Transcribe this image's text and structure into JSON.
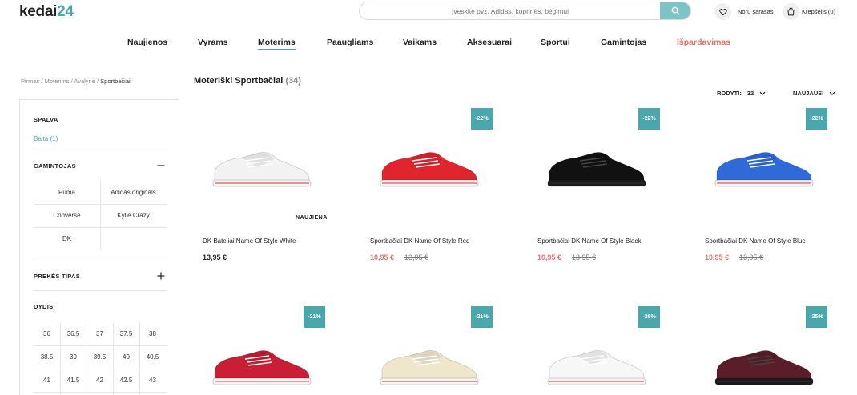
{
  "header": {
    "logo_part1": "kedai",
    "logo_part2": "24",
    "search_placeholder": "Įveskite pvz. Adidas, kuprinės, bėgimui",
    "wishlist_label": "Norų sąrašas",
    "cart_label": "Krepšelis (0)"
  },
  "nav": {
    "items": [
      "Naujienos",
      "Vyrams",
      "Moterims",
      "Paaugliams",
      "Vaikams",
      "Aksesuarai",
      "Sportui",
      "Gamintojas",
      "Išpardavimas"
    ],
    "active": "Moterims",
    "sale_color": "#e3706c"
  },
  "breadcrumb": {
    "items": [
      "Pirmas",
      "Moterims",
      "Avalynė"
    ],
    "separator": "/",
    "current": "Sportbačiai"
  },
  "filters": {
    "color_title": "SPALVA",
    "color_option": "Balta (1)",
    "brand_title": "GAMINTOJAS",
    "brands": [
      "Puma",
      "Adidas originals",
      "Converse",
      "Kylie Crazy",
      "DK"
    ],
    "type_title": "PREKĖS TIPAS",
    "size_title": "DYDIS",
    "sizes": [
      "36",
      "36.5",
      "37",
      "37.5",
      "38",
      "38.5",
      "39",
      "39.5",
      "40",
      "40.5",
      "41",
      "41.5",
      "42",
      "42.5",
      "43"
    ]
  },
  "listing": {
    "title": "Moteriški Sportbačiai",
    "count": "(34)",
    "show_label": "RODYTI:",
    "show_value": "32",
    "sort_label": "NAUJAUSI"
  },
  "products": [
    {
      "name": "DK Bateliai Name Of Style White",
      "price": "13,95 €",
      "old_price": "",
      "badge": "",
      "tag": "NAUJIENA",
      "shoe_color": "#f2f2f2"
    },
    {
      "name": "Sportbačiai DK Name Of Style Red",
      "price": "10,95 €",
      "old_price": "13,95 €",
      "badge": "-22%",
      "tag": "",
      "shoe_color": "#e0252f"
    },
    {
      "name": "Sportbačiai DK Name Of Style Black",
      "price": "10,95 €",
      "old_price": "13,95 €",
      "badge": "-22%",
      "tag": "",
      "shoe_color": "#111111"
    },
    {
      "name": "Sportbačiai DK Name Of Style Blue",
      "price": "10,95 €",
      "old_price": "13,95 €",
      "badge": "-22%",
      "tag": "",
      "shoe_color": "#2f6ad8"
    },
    {
      "name": "",
      "price": "",
      "old_price": "",
      "badge": "-21%",
      "tag": "",
      "shoe_color": "#c81f36"
    },
    {
      "name": "",
      "price": "",
      "old_price": "",
      "badge": "-21%",
      "tag": "",
      "shoe_color": "#efe6cc"
    },
    {
      "name": "",
      "price": "",
      "old_price": "",
      "badge": "-26%",
      "tag": "",
      "shoe_color": "#f7f7f7"
    },
    {
      "name": "",
      "price": "",
      "old_price": "",
      "badge": "-25%",
      "tag": "",
      "shoe_color": "#5a1e2a"
    }
  ],
  "colors": {
    "accent": "#4aa8ad",
    "sale": "#e3706c"
  }
}
